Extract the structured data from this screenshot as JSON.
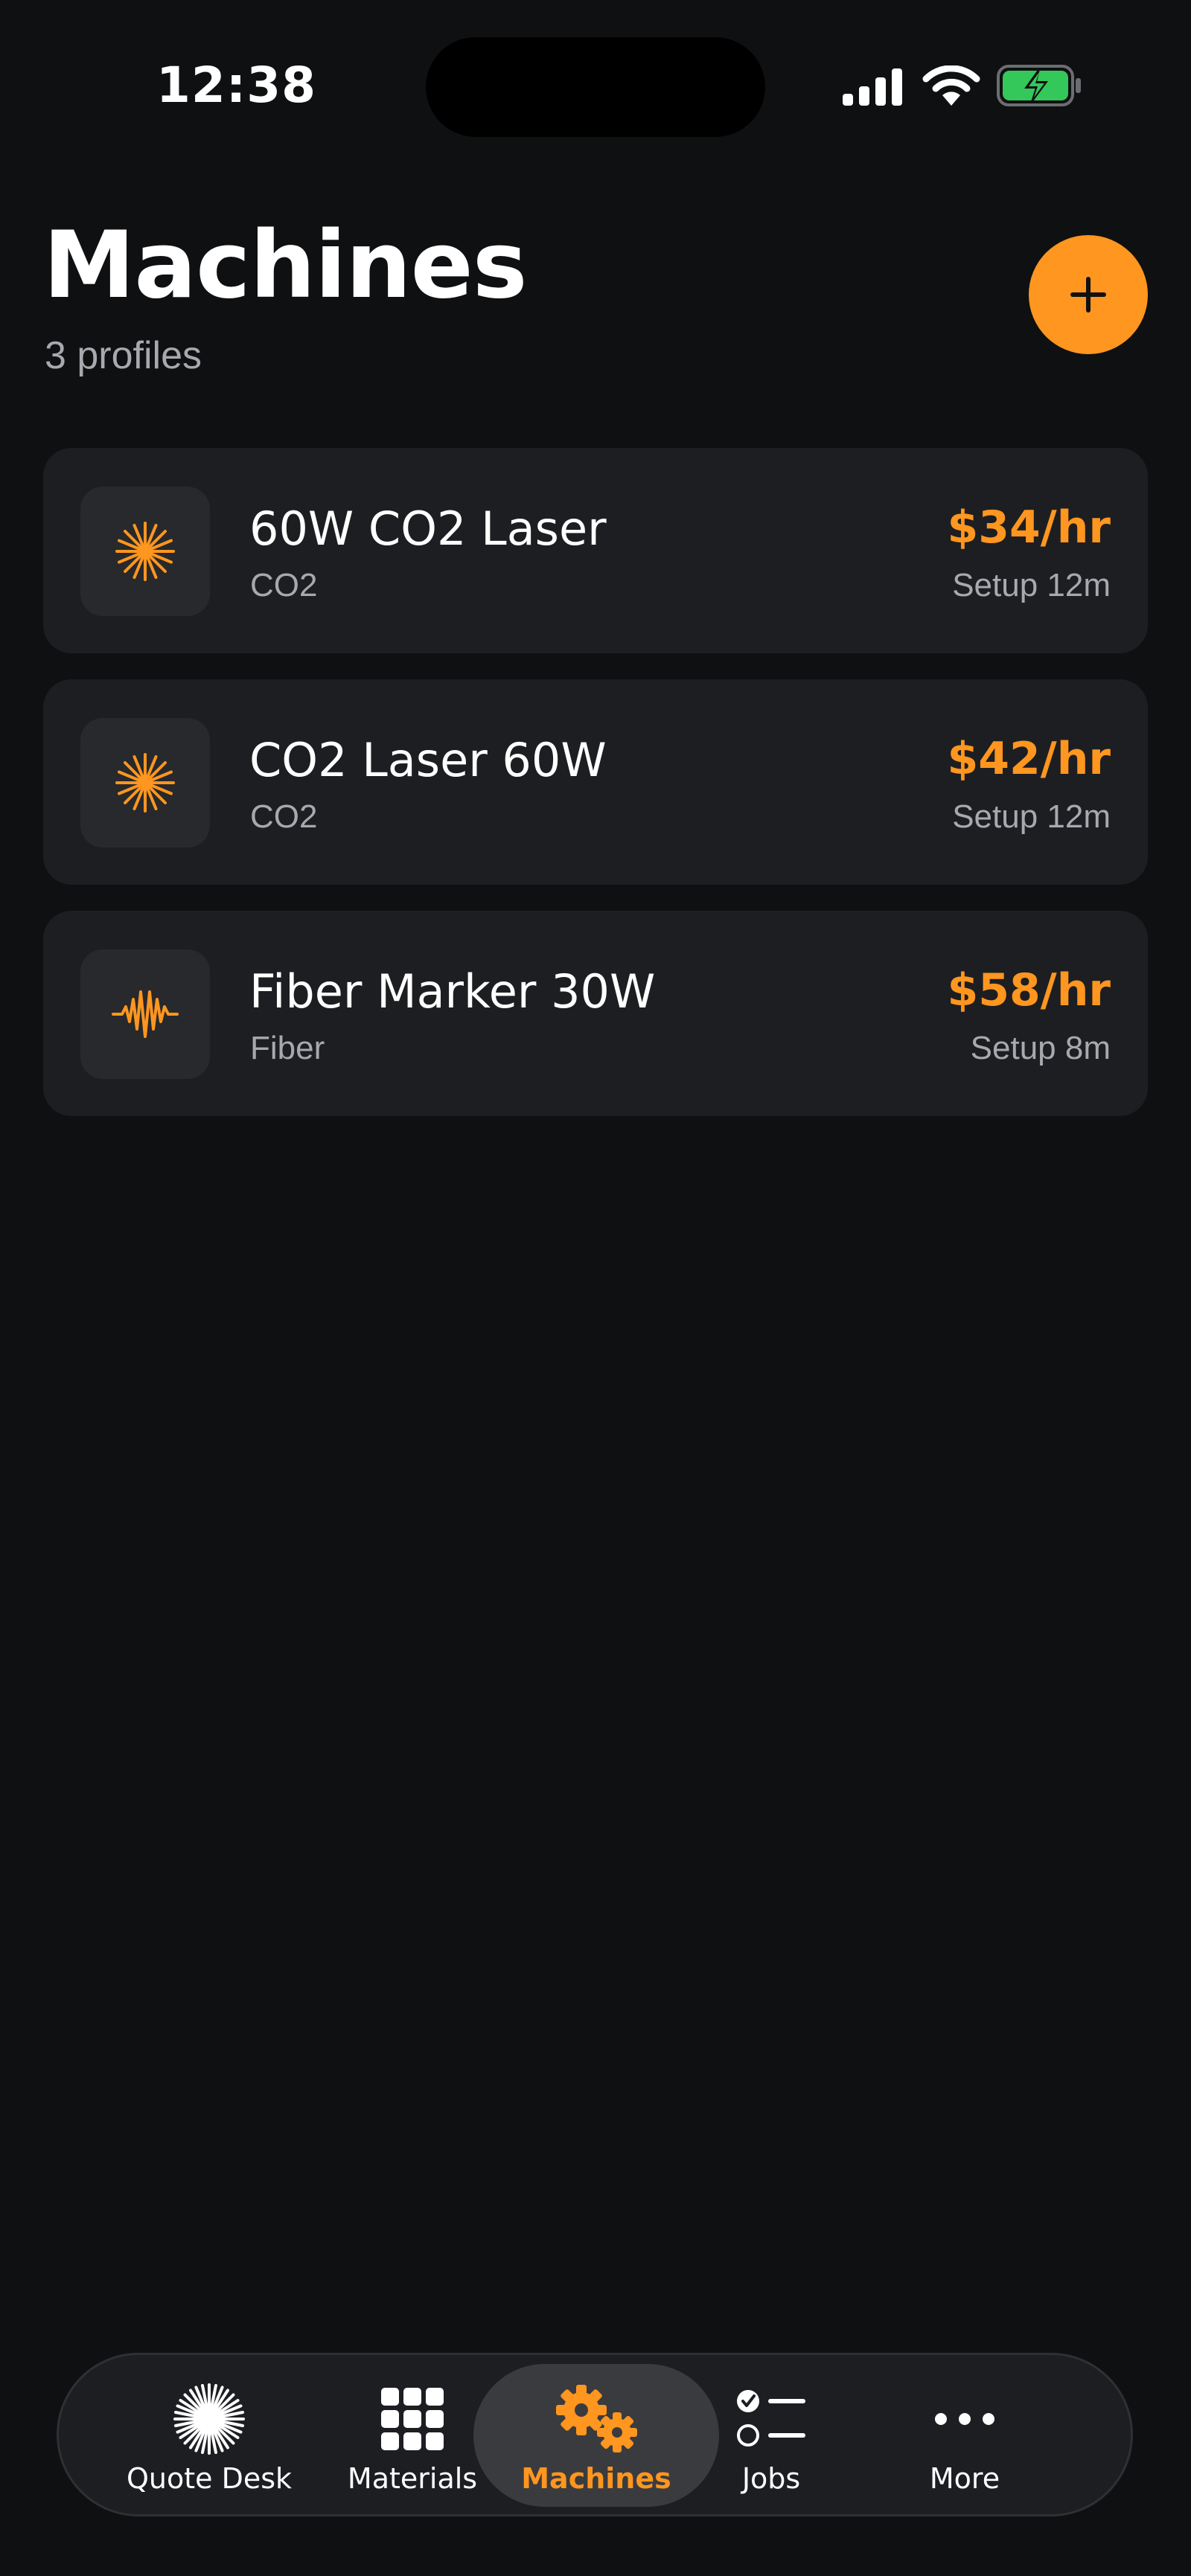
{
  "status_bar": {
    "time": "12:38",
    "battery_color": "#34c759"
  },
  "header": {
    "title": "Machines",
    "subtitle": "3 profiles",
    "add_icon": "plus-icon"
  },
  "accent_color": "#ff961f",
  "machines": [
    {
      "name": "60W CO2 Laser",
      "type": "CO2",
      "rate": "$34/hr",
      "setup": "Setup 12m",
      "icon": "sunburst-icon"
    },
    {
      "name": "CO2 Laser 60W",
      "type": "CO2",
      "rate": "$42/hr",
      "setup": "Setup 12m",
      "icon": "sunburst-icon"
    },
    {
      "name": "Fiber Marker 30W",
      "type": "Fiber",
      "rate": "$58/hr",
      "setup": "Setup 8m",
      "icon": "waveform-icon"
    }
  ],
  "tabs": [
    {
      "label": "Quote Desk",
      "icon": "starburst-icon",
      "active": false
    },
    {
      "label": "Materials",
      "icon": "grid-icon",
      "active": false
    },
    {
      "label": "Machines",
      "icon": "gears-icon",
      "active": true
    },
    {
      "label": "Jobs",
      "icon": "checklist-icon",
      "active": false
    },
    {
      "label": "More",
      "icon": "ellipsis-icon",
      "active": false
    }
  ]
}
